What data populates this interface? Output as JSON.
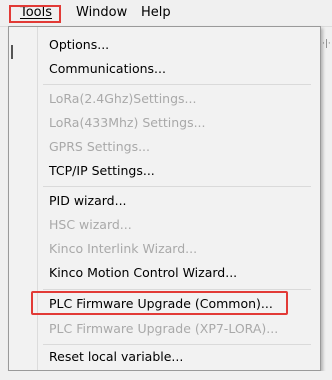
{
  "menubar": {
    "tools": "Tools",
    "window": "Window",
    "help": "Help"
  },
  "tools_menu": {
    "options": "Options...",
    "communications": "Communications...",
    "lora_24": "LoRa(2.4Ghz)Settings...",
    "lora_433": "LoRa(433Mhz) Settings...",
    "gprs": "GPRS Settings...",
    "tcpip": "TCP/IP Settings...",
    "pid_wizard": "PID wizard...",
    "hsc_wizard": "HSC wizard...",
    "kinco_interlink": "Kinco Interlink Wizard...",
    "kinco_motion": "Kinco Motion Control Wizard...",
    "plc_fw_common": "PLC Firmware Upgrade (Common)...",
    "plc_fw_xp7": "PLC Firmware Upgrade (XP7-LORA)...",
    "reset_local": "Reset local variable..."
  },
  "colors": {
    "highlight": "#e23a36",
    "disabled_text": "#a9a9a9"
  }
}
